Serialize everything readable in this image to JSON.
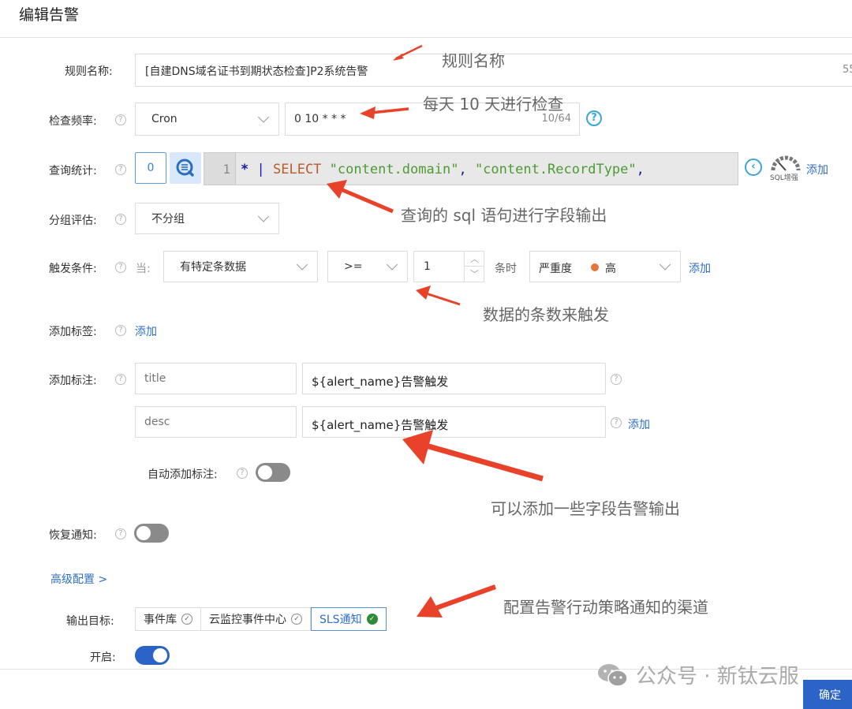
{
  "header": {
    "title": "编辑告警"
  },
  "form": {
    "rule_name": {
      "label": "规则名称:",
      "value": "[自建DNS域名证书到期状态检查]P2系统告警",
      "counter": "55"
    },
    "frequency": {
      "label": "检查频率:",
      "type_value": "Cron",
      "cron_value": "0 10 * * *",
      "counter": "10/64"
    },
    "query": {
      "label": "查询统计:",
      "count": "0",
      "line_number": "1",
      "code": {
        "star": "*",
        "pipe": "|",
        "keyword": "SELECT",
        "str1": "\"content.domain\"",
        "comma1": ",",
        "str2": "\"content.RecordType\"",
        "comma2": ","
      },
      "sql_enhance_label": "SQL增强",
      "add_label": "添加"
    },
    "group": {
      "label": "分组评估:",
      "value": "不分组"
    },
    "trigger": {
      "label": "触发条件:",
      "when_label": "当:",
      "condition_value": "有特定条数据",
      "operator_value": ">=",
      "count_value": "1",
      "suffix": "条时",
      "severity_label": "严重度",
      "severity_value": "高",
      "severity_color": "#e8743b",
      "add_label": "添加"
    },
    "labels": {
      "label": "添加标签:",
      "add_label": "添加"
    },
    "annotations": {
      "label": "添加标注:",
      "rows": [
        {
          "key_placeholder": "title",
          "value": "${alert_name}告警触发"
        },
        {
          "key_placeholder": "desc",
          "value": "${alert_name}告警触发"
        }
      ],
      "add_label": "添加",
      "auto_label": "自动添加标注:",
      "auto_enabled": false
    },
    "recovery": {
      "label": "恢复通知:",
      "enabled": false
    },
    "advanced": {
      "label": "高级配置 >"
    },
    "output": {
      "label": "输出目标:",
      "targets": [
        {
          "label": "事件库",
          "selected": false
        },
        {
          "label": "云监控事件中心",
          "selected": false
        },
        {
          "label": "SLS通知",
          "selected": true
        }
      ]
    },
    "enabled": {
      "label": "开启:",
      "value": true
    }
  },
  "annotations_overlay": {
    "rule_name": "规则名称",
    "frequency": "每天 10 天进行检查",
    "query": "查询的 sql 语句进行字段输出",
    "trigger": "数据的条数来触发",
    "annotations": "可以添加一些字段告警输出",
    "output": "配置告警行动策略通知的渠道"
  },
  "footer": {
    "confirm_label": "确定"
  },
  "watermark": {
    "text": "公众号 · 新钛云服"
  },
  "colors": {
    "primary": "#2b63c7",
    "link": "#2f6fc4",
    "arrow": "#e8432a",
    "success": "#2e8b3a"
  }
}
